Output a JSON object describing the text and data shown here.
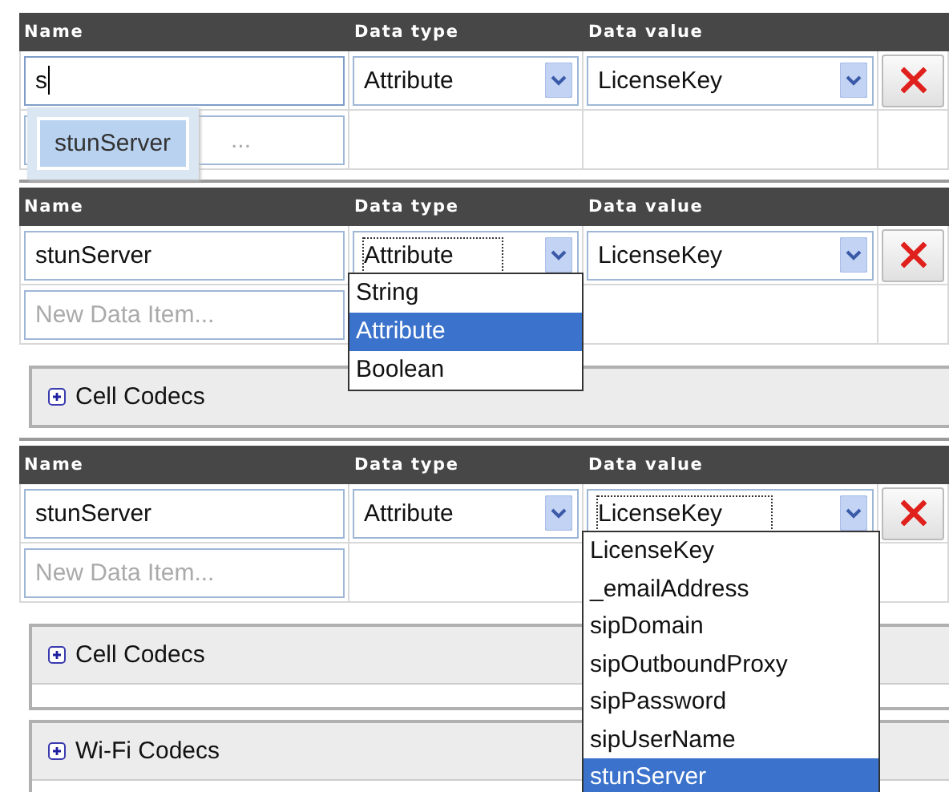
{
  "panels": [
    {
      "columns": [
        "Name",
        "Data type",
        "Data value"
      ],
      "row": {
        "name": "s",
        "name_focused": true,
        "data_type": "Attribute",
        "data_type_focused": false,
        "data_value": "LicenseKey",
        "data_value_focused": false
      },
      "new_item": {
        "placeholder": "..."
      },
      "autocomplete": [
        {
          "label": "stunServer",
          "selected": true
        }
      ]
    },
    {
      "columns": [
        "Name",
        "Data type",
        "Data value"
      ],
      "row": {
        "name": "stunServer",
        "name_focused": false,
        "data_type": "Attribute",
        "data_type_focused": true,
        "data_value": "LicenseKey",
        "data_value_focused": false
      },
      "new_item": {
        "placeholder": "New Data Item..."
      },
      "data_type_options": [
        {
          "label": "String",
          "selected": false
        },
        {
          "label": "Attribute",
          "selected": true
        },
        {
          "label": "Boolean",
          "selected": false
        }
      ],
      "sections": [
        {
          "label": "Cell Codecs",
          "expanded": false
        }
      ]
    },
    {
      "columns": [
        "Name",
        "Data type",
        "Data value"
      ],
      "row": {
        "name": "stunServer",
        "name_focused": false,
        "data_type": "Attribute",
        "data_type_focused": false,
        "data_value": "LicenseKey",
        "data_value_focused": true
      },
      "new_item": {
        "placeholder": "New Data Item..."
      },
      "data_value_options": [
        {
          "label": "LicenseKey",
          "selected": false
        },
        {
          "label": "_emailAddress",
          "selected": false
        },
        {
          "label": "sipDomain",
          "selected": false
        },
        {
          "label": "sipOutboundProxy",
          "selected": false
        },
        {
          "label": "sipPassword",
          "selected": false
        },
        {
          "label": "sipUserName",
          "selected": false
        },
        {
          "label": "stunServer",
          "selected": true
        }
      ],
      "sections": [
        {
          "label": "Cell Codecs",
          "expanded": false
        },
        {
          "label": "Wi-Fi Codecs",
          "expanded": false
        }
      ]
    }
  ]
}
